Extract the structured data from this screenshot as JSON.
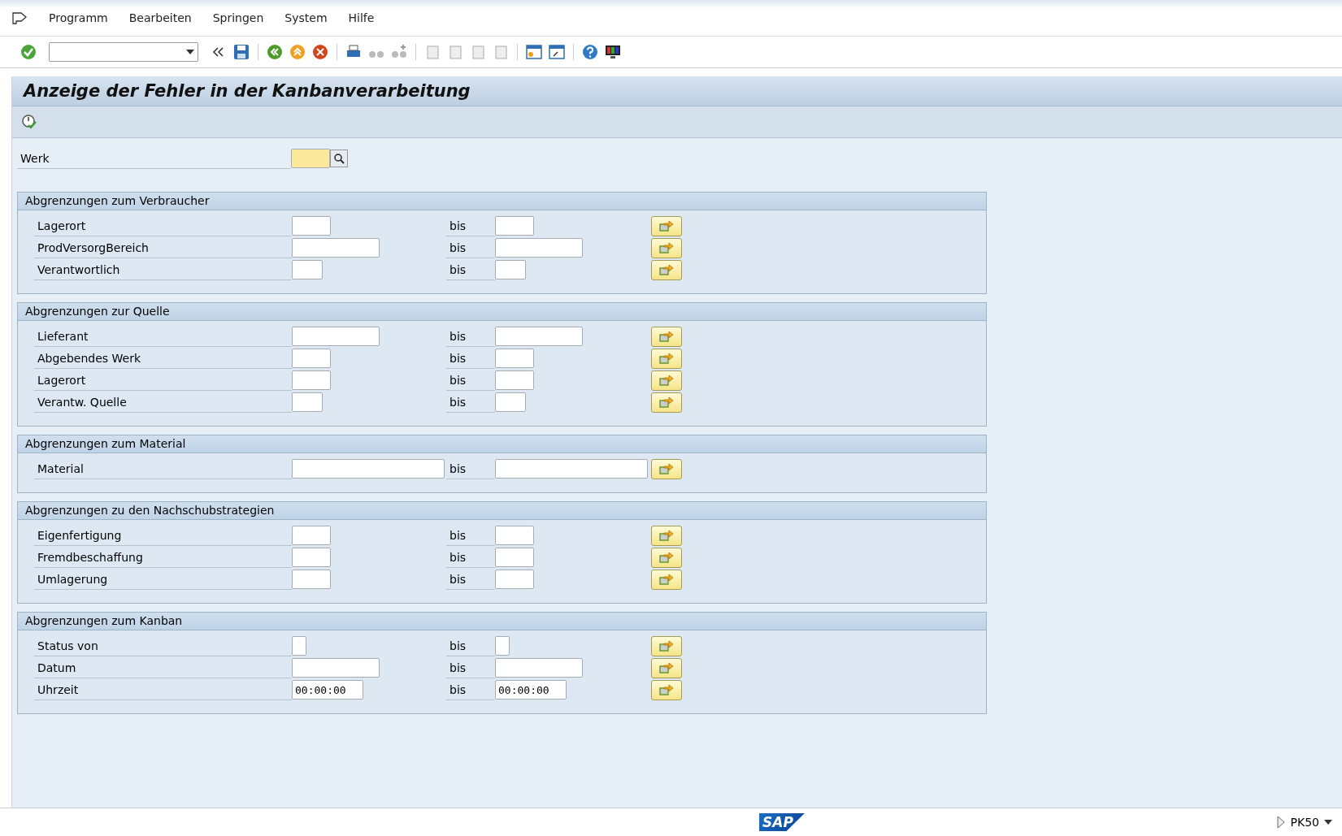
{
  "menu": [
    "Programm",
    "Bearbeiten",
    "Springen",
    "System",
    "Hilfe"
  ],
  "title": "Anzeige der Fehler in der Kanbanverarbeitung",
  "werk": {
    "label": "Werk",
    "required": true
  },
  "sections": [
    {
      "title": "Abgrenzungen zum Verbraucher",
      "rows": [
        {
          "label": "Lagerort",
          "kind": "s",
          "to": "bis"
        },
        {
          "label": "ProdVersorgBereich",
          "kind": "m",
          "to": "bis"
        },
        {
          "label": "Verantwortlich",
          "kind": "xs",
          "to": "bis"
        }
      ]
    },
    {
      "title": "Abgrenzungen zur Quelle",
      "rows": [
        {
          "label": "Lieferant",
          "kind": "m",
          "to": "bis"
        },
        {
          "label": "Abgebendes Werk",
          "kind": "s",
          "to": "bis"
        },
        {
          "label": "Lagerort",
          "kind": "s",
          "to": "bis"
        },
        {
          "label": "Verantw. Quelle",
          "kind": "xs",
          "to": "bis"
        }
      ]
    },
    {
      "title": "Abgrenzungen zum Material",
      "rows": [
        {
          "label": "Material",
          "kind": "l",
          "to": "bis"
        }
      ]
    },
    {
      "title": "Abgrenzungen zu den Nachschubstrategien",
      "rows": [
        {
          "label": "Eigenfertigung",
          "kind": "s",
          "to": "bis"
        },
        {
          "label": "Fremdbeschaffung",
          "kind": "s",
          "to": "bis"
        },
        {
          "label": "Umlagerung",
          "kind": "s",
          "to": "bis"
        }
      ]
    },
    {
      "title": "Abgrenzungen zum Kanban",
      "rows": [
        {
          "label": "Status von",
          "kind": "xxs",
          "to": "bis"
        },
        {
          "label": "Datum",
          "kind": "m",
          "to": "bis"
        },
        {
          "label": "Uhrzeit",
          "kind": "t",
          "to": "bis",
          "value": "00:00:00",
          "value_to": "00:00:00"
        }
      ]
    }
  ],
  "status_bar": {
    "logo": "SAP",
    "transaction": "PK50"
  }
}
